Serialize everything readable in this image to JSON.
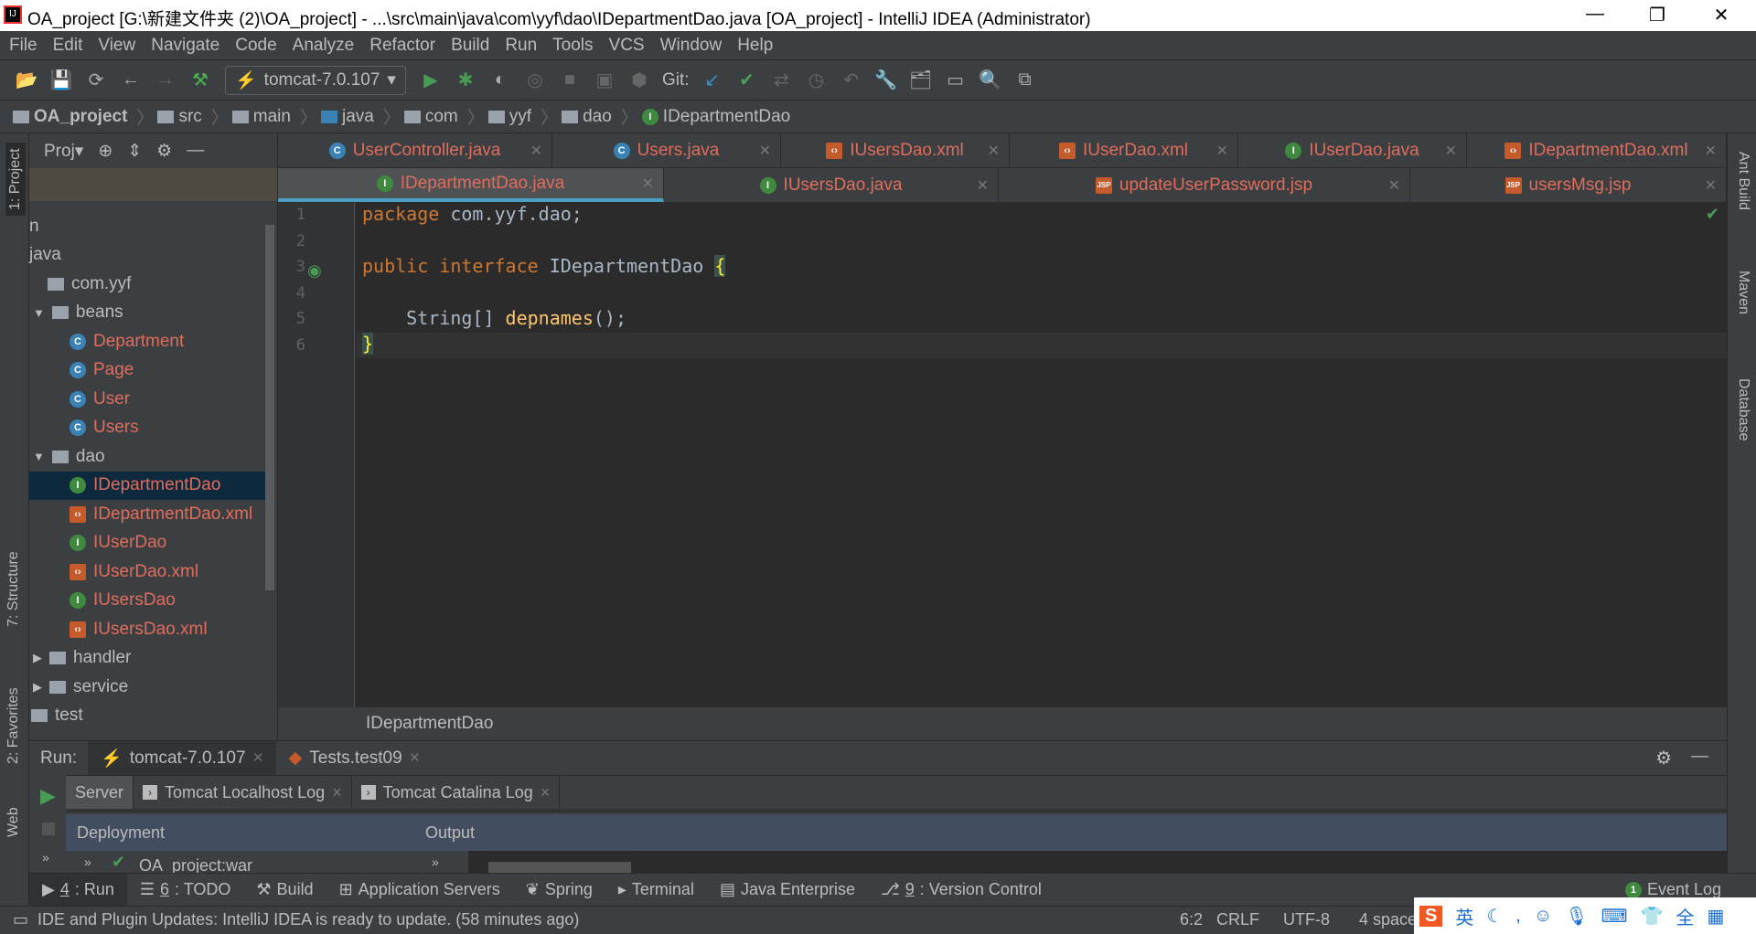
{
  "window": {
    "title": "OA_project [G:\\新建文件夹 (2)\\OA_project] - ...\\src\\main\\java\\com\\yyf\\dao\\IDepartmentDao.java [OA_project] - IntelliJ IDEA (Administrator)"
  },
  "menu": [
    "File",
    "Edit",
    "View",
    "Navigate",
    "Code",
    "Analyze",
    "Refactor",
    "Build",
    "Run",
    "Tools",
    "VCS",
    "Window",
    "Help"
  ],
  "toolbar": {
    "run_config": "tomcat-7.0.107",
    "git_label": "Git:"
  },
  "breadcrumb": [
    "OA_project",
    "src",
    "main",
    "java",
    "com",
    "yyf",
    "dao",
    "IDepartmentDao"
  ],
  "project_panel": {
    "title": "Proj▾",
    "tree": [
      {
        "label": "n",
        "type": "text",
        "indent": 0
      },
      {
        "label": "java",
        "type": "text",
        "indent": 0
      },
      {
        "label": "com.yyf",
        "type": "folder",
        "indent": 1
      },
      {
        "label": "beans",
        "type": "folder",
        "indent": 1,
        "expanded": true
      },
      {
        "label": "Department",
        "type": "class",
        "indent": 3
      },
      {
        "label": "Page",
        "type": "class",
        "indent": 3
      },
      {
        "label": "User",
        "type": "class",
        "indent": 3
      },
      {
        "label": "Users",
        "type": "class",
        "indent": 3
      },
      {
        "label": "dao",
        "type": "folder",
        "indent": 1,
        "expanded": true
      },
      {
        "label": "IDepartmentDao",
        "type": "interface",
        "indent": 3,
        "selected": true
      },
      {
        "label": "IDepartmentDao.xml",
        "type": "xml",
        "indent": 3
      },
      {
        "label": "IUserDao",
        "type": "interface",
        "indent": 3
      },
      {
        "label": "IUserDao.xml",
        "type": "xml",
        "indent": 3
      },
      {
        "label": "IUsersDao",
        "type": "interface",
        "indent": 3
      },
      {
        "label": "IUsersDao.xml",
        "type": "xml",
        "indent": 3
      },
      {
        "label": "handler",
        "type": "folder",
        "indent": 1,
        "expanded": false
      },
      {
        "label": "service",
        "type": "folder",
        "indent": 1,
        "expanded": false
      },
      {
        "label": "test",
        "type": "folder",
        "indent": 0
      }
    ]
  },
  "left_strip": [
    "1: Project",
    "7: Structure",
    "2: Favorites",
    "Web"
  ],
  "right_strip": [
    "Ant Build",
    "Maven",
    "Database"
  ],
  "tabs_row1": [
    {
      "label": "UserController.java",
      "icon": "class"
    },
    {
      "label": "Users.java",
      "icon": "class"
    },
    {
      "label": "IUsersDao.xml",
      "icon": "xml"
    },
    {
      "label": "IUserDao.xml",
      "icon": "xml"
    },
    {
      "label": "IUserDao.java",
      "icon": "interface"
    },
    {
      "label": "IDepartmentDao.xml",
      "icon": "xml"
    }
  ],
  "tabs_row2": [
    {
      "label": "IDepartmentDao.java",
      "icon": "interface",
      "active": true
    },
    {
      "label": "IUsersDao.java",
      "icon": "interface"
    },
    {
      "label": "updateUserPassword.jsp",
      "icon": "jsp"
    },
    {
      "label": "usersMsg.jsp",
      "icon": "jsp"
    }
  ],
  "editor": {
    "line_numbers": [
      "1",
      "2",
      "3",
      "4",
      "5",
      "6"
    ],
    "code": {
      "l1_kw": "package",
      "l1_rest": " com.yyf.dao;",
      "l3_kw1": "public",
      "l3_kw2": "interface",
      "l3_name": " IDepartmentDao ",
      "l3_brace": "{",
      "l5_type": "    String[] ",
      "l5_fn": "depnames",
      "l5_rest": "();",
      "l6_brace": "}"
    },
    "breadcrumb": "IDepartmentDao"
  },
  "run_panel": {
    "label": "Run:",
    "tabs": [
      "tomcat-7.0.107",
      "Tests.test09"
    ],
    "subtabs": [
      "Server",
      "Tomcat Localhost Log",
      "Tomcat Catalina Log"
    ],
    "columns": [
      "Deployment",
      "Output"
    ],
    "deployment": "OA_project:war"
  },
  "bottom_tabs": [
    {
      "key": "4",
      "label": ": Run"
    },
    {
      "key": "6",
      "label": ": TODO"
    },
    {
      "label": "Build"
    },
    {
      "label": "Application Servers"
    },
    {
      "label": "Spring"
    },
    {
      "label": "Terminal"
    },
    {
      "label": "Java Enterprise"
    },
    {
      "key": "9",
      "label": ": Version Control"
    }
  ],
  "event_log": {
    "count": "1",
    "label": "Event Log"
  },
  "status": {
    "message": "IDE and Plugin Updates: IntelliJ IDEA is ready to update. (58 minutes ago)",
    "position": "6:2",
    "line_sep": "CRLF",
    "encoding": "UTF-8",
    "indent": "4 space",
    "ime": "英"
  },
  "colors": {
    "accent": "#4a9fc4",
    "error_file": "#e06c5c",
    "keyword": "#cc7832",
    "function": "#ffc66d",
    "selection": "#0d293e"
  }
}
